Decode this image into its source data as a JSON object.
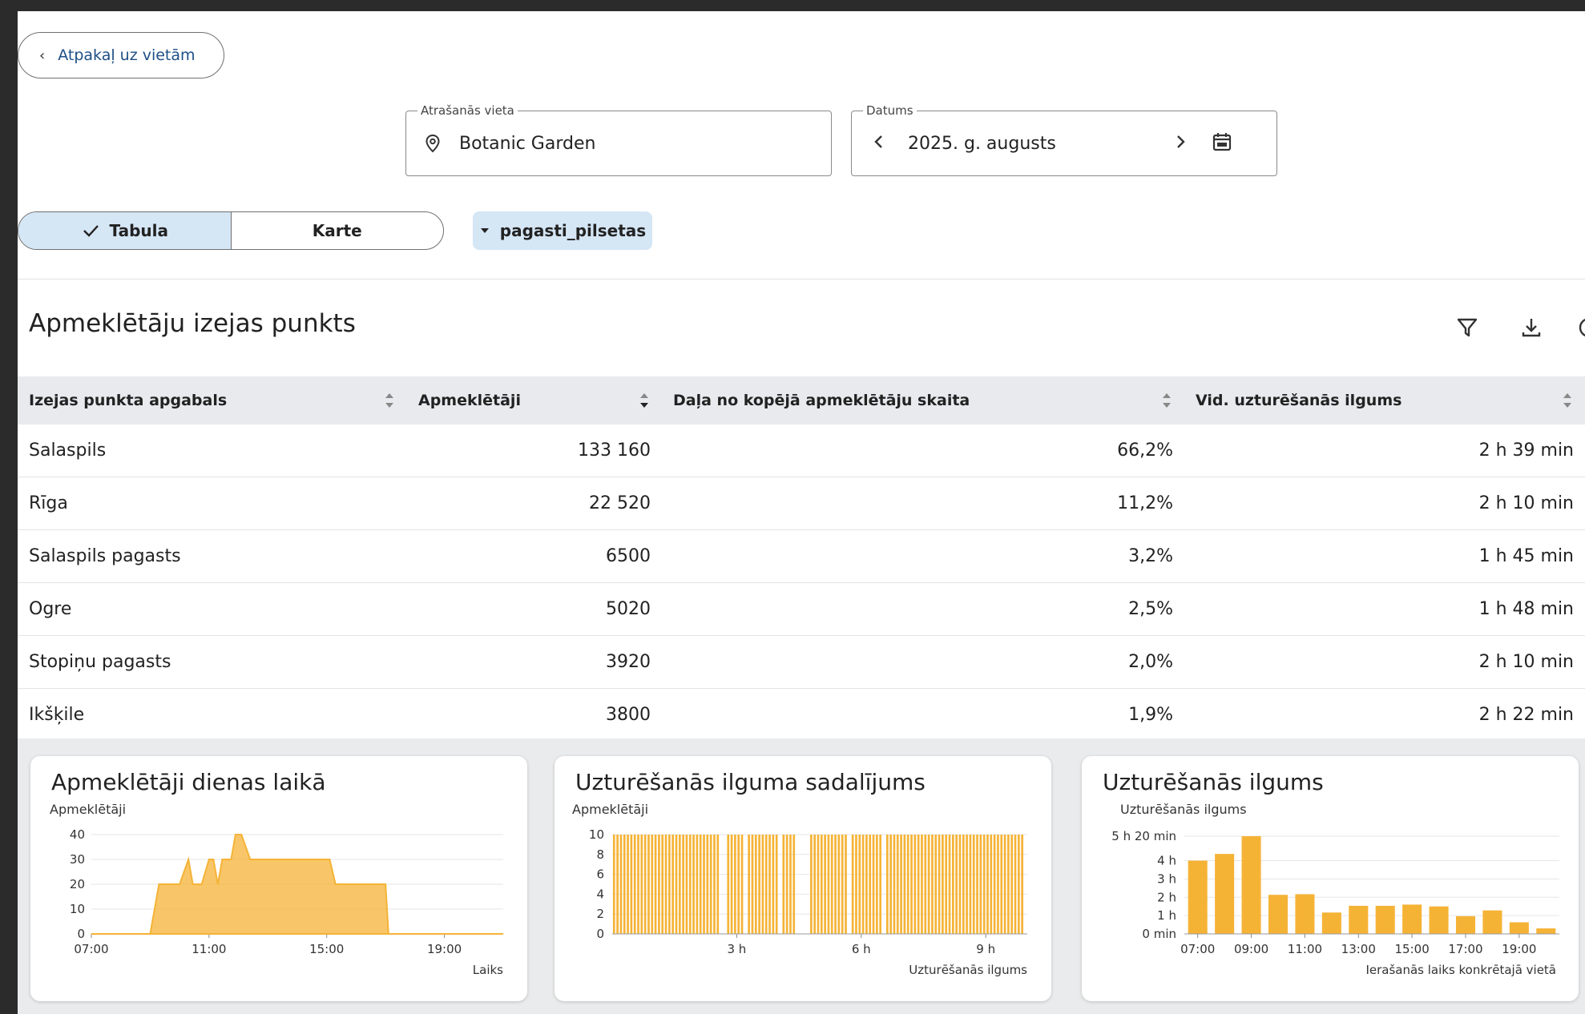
{
  "back_button": {
    "label": "Atpakaļ uz vietām"
  },
  "location_field": {
    "legend": "Atrašanās vieta",
    "value": "Botanic Garden"
  },
  "date_field": {
    "legend": "Datums",
    "value": "2025. g. augusts"
  },
  "view_toggle": {
    "table_label": "Tabula",
    "map_label": "Karte",
    "selected": "Tabula"
  },
  "filter_chip": {
    "label": "pagasti_pilsetas"
  },
  "section": {
    "title": "Apmeklētāju izejas punkts"
  },
  "table": {
    "columns": [
      "Izejas punkta apgabals",
      "Apmeklētāji",
      "Daļa no kopējā apmeklētāju skaita",
      "Vid. uzturēšanās ilgums"
    ],
    "rows": [
      [
        "Salaspils",
        "133 160",
        "66,2%",
        "2 h 39 min"
      ],
      [
        "Rīga",
        "22 520",
        "11,2%",
        "2 h 10 min"
      ],
      [
        "Salaspils pagasts",
        "6500",
        "3,2%",
        "1 h 45 min"
      ],
      [
        "Ogre",
        "5020",
        "2,5%",
        "1 h 48 min"
      ],
      [
        "Stopiņu pagasts",
        "3920",
        "2,0%",
        "2 h 10 min"
      ],
      [
        "Ikšķile",
        "3800",
        "1,9%",
        "2 h 22 min"
      ]
    ]
  },
  "icons": {
    "back": "chevron-left-icon",
    "location": "location-pin-icon",
    "prev": "chevron-left-icon",
    "next": "chevron-right-icon",
    "calendar": "calendar-icon",
    "check": "check-icon",
    "caret": "caret-down-icon",
    "filter": "filter-icon",
    "download": "download-icon",
    "sort": "sort-icon"
  },
  "colors": {
    "accent": "#f5b336",
    "chip_bg": "#d5e6f5",
    "header_bg": "#e8eaed"
  },
  "chart_data": [
    {
      "type": "area",
      "title": "Apmeklētāji dienas laikā",
      "ylabel": "Apmeklētāji",
      "xlabel": "Laiks",
      "x_ticks": [
        "07:00",
        "11:00",
        "15:00",
        "19:00"
      ],
      "y_ticks": [
        "0",
        "10",
        "20",
        "30",
        "40"
      ],
      "ylim": [
        0,
        40
      ],
      "xlim": [
        7,
        21
      ],
      "x": [
        7,
        9.0,
        9.3,
        10.0,
        10.3,
        10.45,
        10.6,
        10.75,
        11.0,
        11.15,
        11.3,
        11.45,
        11.6,
        11.75,
        11.9,
        12.1,
        12.4,
        12.65,
        12.8,
        13.0,
        13.2,
        15.1,
        15.3,
        17.0,
        17.1,
        21
      ],
      "y": [
        0,
        0,
        20,
        20,
        30,
        20,
        20,
        20,
        30,
        30,
        20,
        30,
        30,
        30,
        40,
        40,
        30,
        30,
        30,
        30,
        30,
        30,
        20,
        20,
        0,
        0
      ],
      "grid": true
    },
    {
      "type": "bar",
      "title": "Uzturēšanās ilguma sadalījums",
      "ylabel": "Apmeklētāji",
      "xlabel": "Uzturēšanās ilgums",
      "x_ticks": [
        "3 h",
        "6 h",
        "9 h"
      ],
      "y_ticks": [
        "0",
        "2",
        "4",
        "6",
        "8",
        "10"
      ],
      "ylim": [
        0,
        10
      ],
      "xlim": [
        0,
        600
      ],
      "x_unit": "min",
      "bar_width": 5,
      "x": [
        5,
        10,
        15,
        20,
        25,
        30,
        35,
        40,
        45,
        50,
        55,
        60,
        65,
        70,
        75,
        80,
        85,
        90,
        95,
        100,
        105,
        110,
        115,
        120,
        125,
        130,
        135,
        140,
        145,
        150,
        155,
        160,
        165,
        170,
        175,
        180,
        185,
        190,
        195,
        200,
        205,
        210,
        215,
        220,
        225,
        230,
        235,
        240,
        245,
        250,
        255,
        260,
        265,
        270,
        275,
        280,
        285,
        290,
        295,
        300,
        305,
        310,
        315,
        320,
        325,
        330,
        335,
        340,
        345,
        350,
        355,
        360,
        365,
        370,
        375,
        380,
        385,
        390,
        395,
        400,
        405,
        410,
        415,
        420,
        425,
        430,
        435,
        440,
        445,
        450,
        455,
        460,
        465,
        470,
        475,
        480,
        485,
        490,
        495,
        500,
        505,
        510,
        515,
        520,
        525,
        530,
        535,
        540,
        545,
        550,
        555,
        560,
        565,
        570,
        575,
        580,
        585,
        590,
        595
      ],
      "values": [
        10,
        10,
        10,
        10,
        10,
        10,
        10,
        10,
        10,
        10,
        10,
        10,
        10,
        10,
        10,
        10,
        10,
        10,
        10,
        10,
        10,
        10,
        10,
        10,
        10,
        10,
        10,
        10,
        10,
        10,
        10,
        0,
        0,
        10,
        10,
        10,
        10,
        10,
        0,
        10,
        10,
        10,
        10,
        10,
        10,
        10,
        10,
        10,
        0,
        10,
        10,
        10,
        10,
        0,
        0,
        0,
        0,
        10,
        10,
        10,
        10,
        10,
        10,
        10,
        10,
        10,
        10,
        10,
        0,
        10,
        10,
        10,
        10,
        10,
        10,
        10,
        10,
        10,
        0,
        10,
        10,
        10,
        10,
        10,
        10,
        10,
        10,
        10,
        10,
        10,
        10,
        10,
        10,
        10,
        10,
        10,
        10,
        10,
        10,
        10,
        10,
        10,
        10,
        10,
        10,
        10,
        10,
        10,
        10,
        10,
        10,
        10,
        10,
        10,
        10,
        10,
        10,
        10,
        10
      ],
      "grid": true
    },
    {
      "type": "bar",
      "title": "Uzturēšanās ilgums",
      "ylabel": "Uzturēšanās ilgums",
      "xlabel": "Ierašanās laiks konkrētajā vietā",
      "x_ticks": [
        "07:00",
        "09:00",
        "11:00",
        "13:00",
        "15:00",
        "17:00",
        "19:00"
      ],
      "y_ticks": [
        "0 min",
        "1 h",
        "2 h",
        "3 h",
        "4 h",
        "5 h 20 min"
      ],
      "y_tick_values": [
        0,
        60,
        120,
        180,
        240,
        320
      ],
      "ylim": [
        0,
        320
      ],
      "y_unit": "min",
      "categories": [
        "07:00",
        "08:00",
        "09:00",
        "10:00",
        "11:00",
        "12:00",
        "13:00",
        "14:00",
        "15:00",
        "16:00",
        "17:00",
        "18:00",
        "19:00",
        "20:00"
      ],
      "values": [
        240,
        262,
        320,
        128,
        130,
        70,
        92,
        92,
        96,
        90,
        58,
        77,
        38,
        18
      ],
      "grid": true
    }
  ]
}
